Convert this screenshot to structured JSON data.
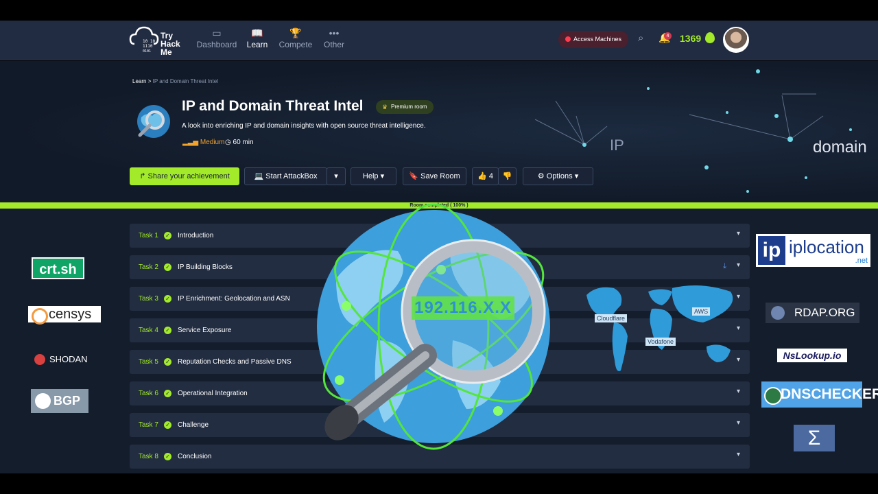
{
  "brand": {
    "logo_text": "Try Hack Me",
    "accent": "#a3ea2a"
  },
  "nav": {
    "items": [
      {
        "label": "Dashboard",
        "icon": "dashboard-icon"
      },
      {
        "label": "Learn",
        "icon": "book-icon"
      },
      {
        "label": "Compete",
        "icon": "trophy-icon"
      },
      {
        "label": "Other",
        "icon": "more-icon"
      }
    ],
    "access_button": "Access Machines",
    "notification_count": "4",
    "points": "1369"
  },
  "breadcrumb": {
    "root": "Learn",
    "separator": ">",
    "current": "IP and Domain Threat Intel"
  },
  "room": {
    "title": "IP and Domain Threat Intel",
    "badge": "Premium room",
    "description": "A look into enriching IP and domain insights with open source threat intelligence.",
    "difficulty": "Medium",
    "duration": "60 min"
  },
  "hero_labels": {
    "ip": "IP",
    "domain": "domain"
  },
  "actions": {
    "share": "Share your achievement",
    "attackbox": "Start AttackBox",
    "help": "Help",
    "save": "Save Room",
    "likes": "4",
    "options": "Options"
  },
  "progress": {
    "label": "Room completed ( 100% )",
    "percent": 100
  },
  "tasks": [
    {
      "num": "Task 1",
      "title": "Introduction"
    },
    {
      "num": "Task 2",
      "title": "IP Building Blocks"
    },
    {
      "num": "Task 3",
      "title": "IP Enrichment: Geolocation and ASN"
    },
    {
      "num": "Task 4",
      "title": "Service Exposure"
    },
    {
      "num": "Task 5",
      "title": "Reputation Checks and Passive DNS"
    },
    {
      "num": "Task 6",
      "title": "Operational Integration"
    },
    {
      "num": "Task 7",
      "title": "Challenge"
    },
    {
      "num": "Task 8",
      "title": "Conclusion"
    }
  ],
  "overlay": {
    "ip_text": "192.116.X.X",
    "map_labels": [
      "Cloudflare",
      "AWS",
      "Vodafone"
    ]
  },
  "side_logos": {
    "left": [
      "crt.sh",
      "censys",
      "SHODAN",
      "BGP"
    ],
    "right": [
      "ip",
      "iplocation",
      ".net",
      "RDAP.ORG",
      "NsLookup.io",
      "DNSCHECKER",
      "Σ"
    ]
  }
}
